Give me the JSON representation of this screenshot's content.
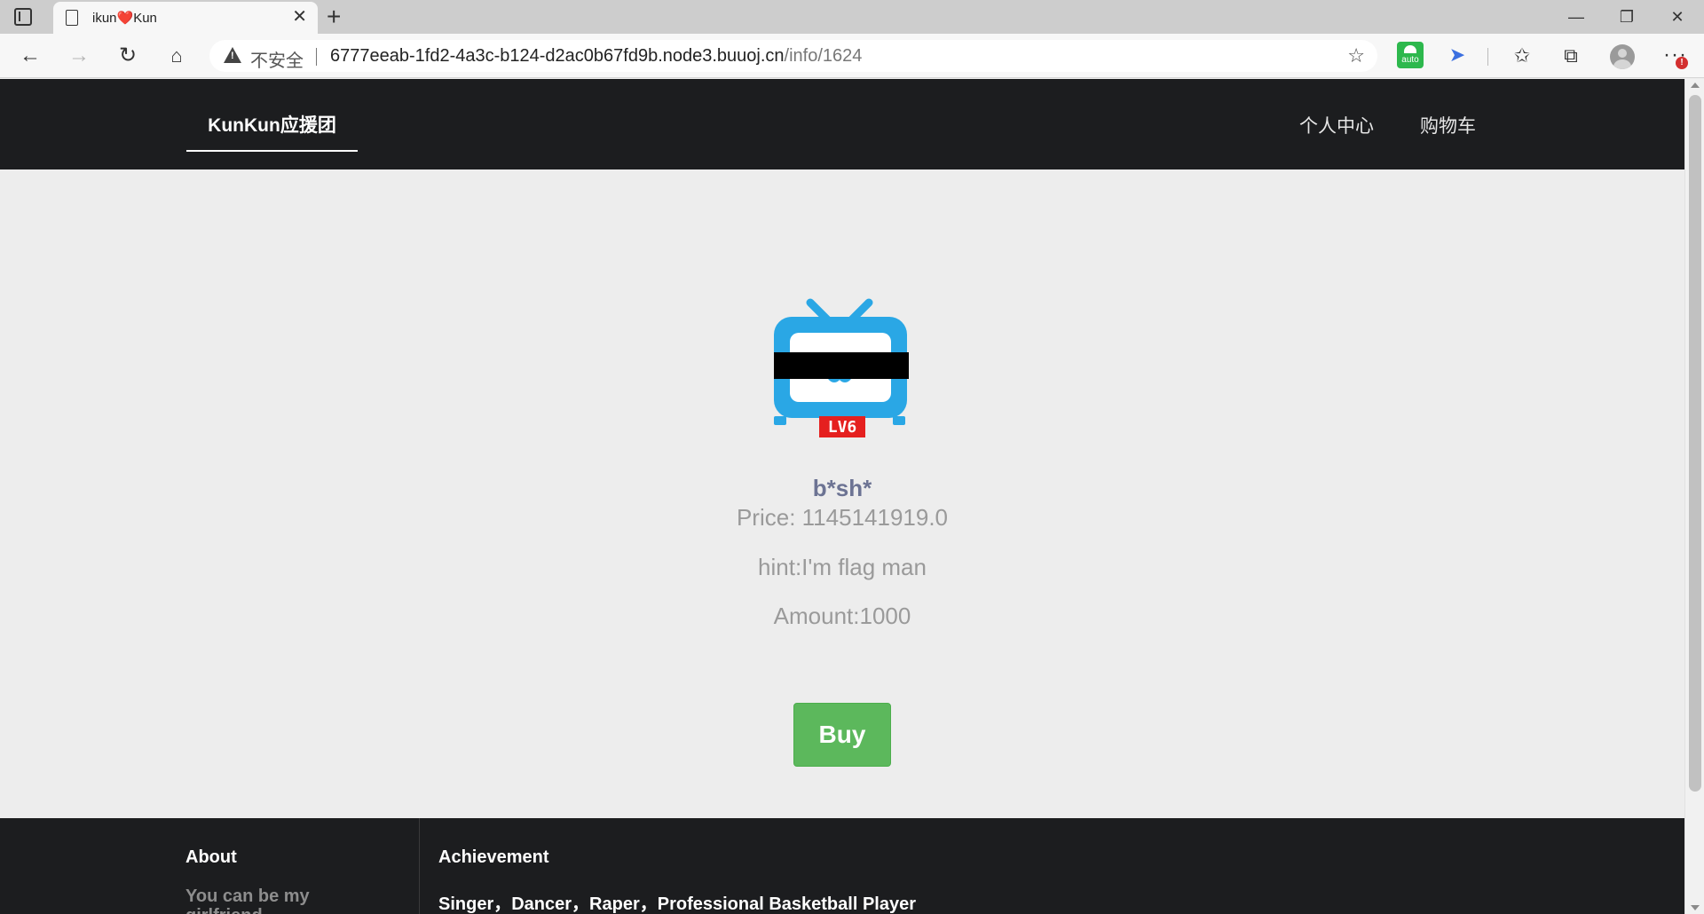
{
  "browser": {
    "tab": {
      "title": "ikun❤️Kun"
    },
    "address_bar": {
      "security_label": "不安全",
      "url_host": "6777eeab-1fd2-4a3c-b124-d2ac0b67fd9b.node3.buuoj.cn",
      "url_path": "/info/1624"
    },
    "extensions": {
      "auto_label": "auto"
    },
    "alert_badge": "!"
  },
  "site": {
    "brand": "KunKun应援团",
    "nav": {
      "profile": "个人中心",
      "cart": "购物车"
    }
  },
  "product": {
    "badge": "LV6",
    "name": "b*sh*",
    "price": "Price: 1145141919.0",
    "hint": "hint:I'm flag man",
    "amount": "Amount:1000",
    "buy_label": "Buy"
  },
  "footer": {
    "about_title": "About",
    "about_text": "You can be my girlfriend",
    "achievement_title": "Achievement",
    "achievement_text": "Singer，Dancer，Raper，Professional Basketball Player"
  },
  "colors": {
    "nav_bg": "#1c1d1f",
    "page_bg": "#ededed",
    "buy_green": "#5cb85c",
    "product_name": "#6c7393",
    "tv_blue": "#2aa7e5",
    "lv_red": "#e5201f"
  }
}
